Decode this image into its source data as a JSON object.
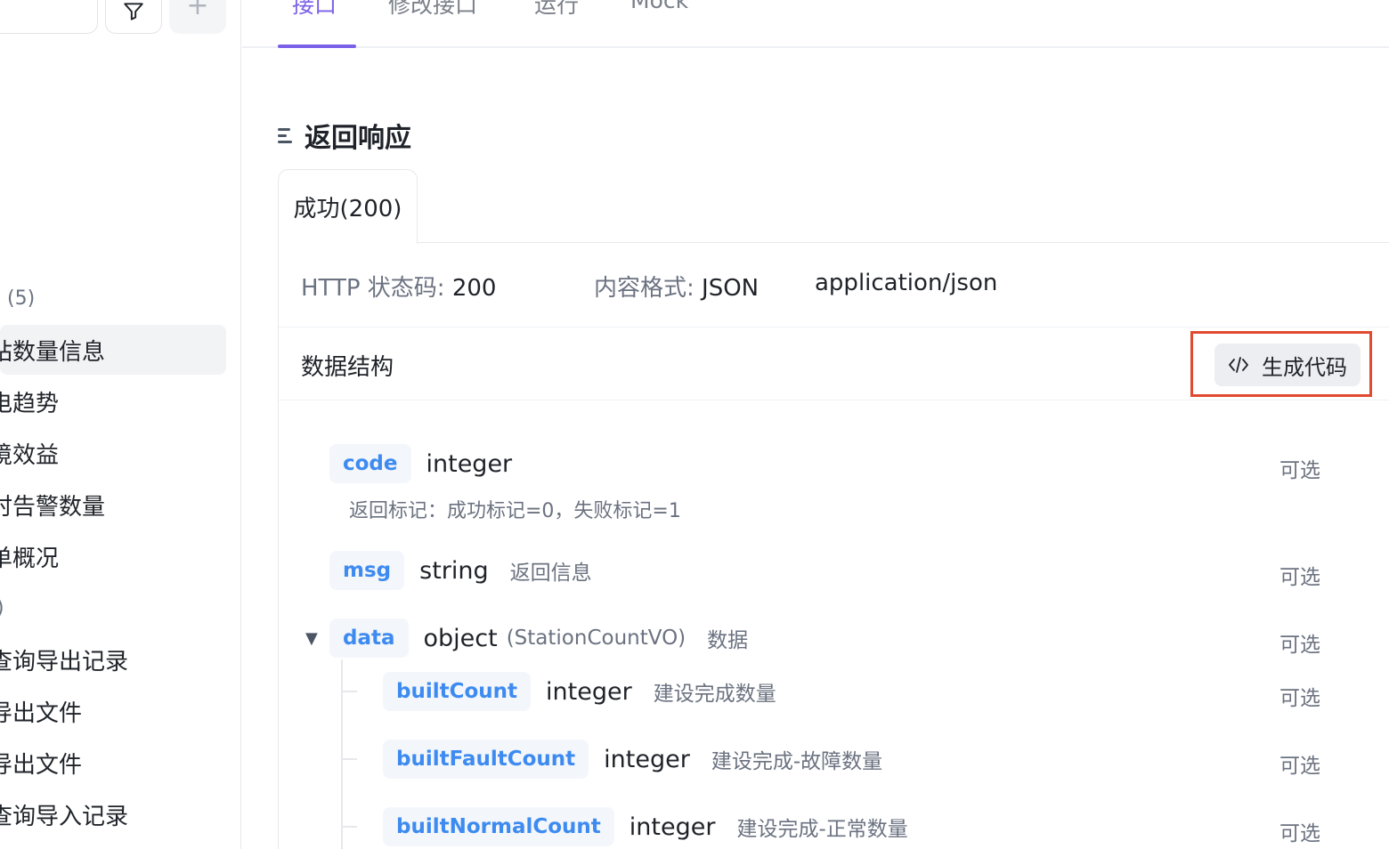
{
  "sidebar": {
    "add_symbol": "+",
    "tree": [
      {
        "label": "(5)",
        "kind": "group"
      },
      {
        "label": "站数量信息",
        "kind": "item",
        "active": true
      },
      {
        "label": "电趋势",
        "kind": "item"
      },
      {
        "label": "境效益",
        "kind": "item"
      },
      {
        "label": "时告警数量",
        "kind": "item"
      },
      {
        "label": "单概况",
        "kind": "item"
      },
      {
        "label": ")",
        "kind": "group"
      },
      {
        "label": "查询导出记录",
        "kind": "item"
      },
      {
        "label": "导出文件",
        "kind": "item"
      },
      {
        "label": "导出文件",
        "kind": "item"
      },
      {
        "label": "查询导入记录",
        "kind": "item"
      }
    ]
  },
  "tabs": {
    "items": [
      "接口",
      "修改接口",
      "运行",
      "Mock"
    ],
    "active_index": 0
  },
  "response": {
    "section_title": "返回响应",
    "tab_label": "成功(200)",
    "http_status_key": "HTTP 状态码: ",
    "http_status_value": "200",
    "content_format_key": "内容格式: ",
    "content_format_value": "JSON",
    "content_type": "application/json",
    "data_structure_title": "数据结构",
    "generate_code_label": "生成代码",
    "generate_code_icon": "code-icon"
  },
  "fields": [
    {
      "name": "code",
      "type": "integer",
      "ref": "",
      "desc": "",
      "subdesc": "返回标记：成功标记=0，失败标记=1",
      "optional": "可选"
    },
    {
      "name": "msg",
      "type": "string",
      "ref": "",
      "desc": "返回信息",
      "subdesc": "",
      "optional": "可选"
    },
    {
      "name": "data",
      "type": "object",
      "ref": "(StationCountVO)",
      "desc": "数据",
      "subdesc": "",
      "optional": "可选",
      "expand_icon": "caret-down-icon"
    },
    {
      "name": "builtCount",
      "type": "integer",
      "ref": "",
      "desc": "建设完成数量",
      "subdesc": "",
      "optional": "可选"
    },
    {
      "name": "builtFaultCount",
      "type": "integer",
      "ref": "",
      "desc": "建设完成-故障数量",
      "subdesc": "",
      "optional": "可选"
    },
    {
      "name": "builtNormalCount",
      "type": "integer",
      "ref": "",
      "desc": "建设完成-正常数量",
      "subdesc": "",
      "optional": "可选"
    }
  ],
  "colors": {
    "accent": "#7b61e8",
    "field_name": "#3d8bf0",
    "highlight_border": "#e04a2f"
  }
}
